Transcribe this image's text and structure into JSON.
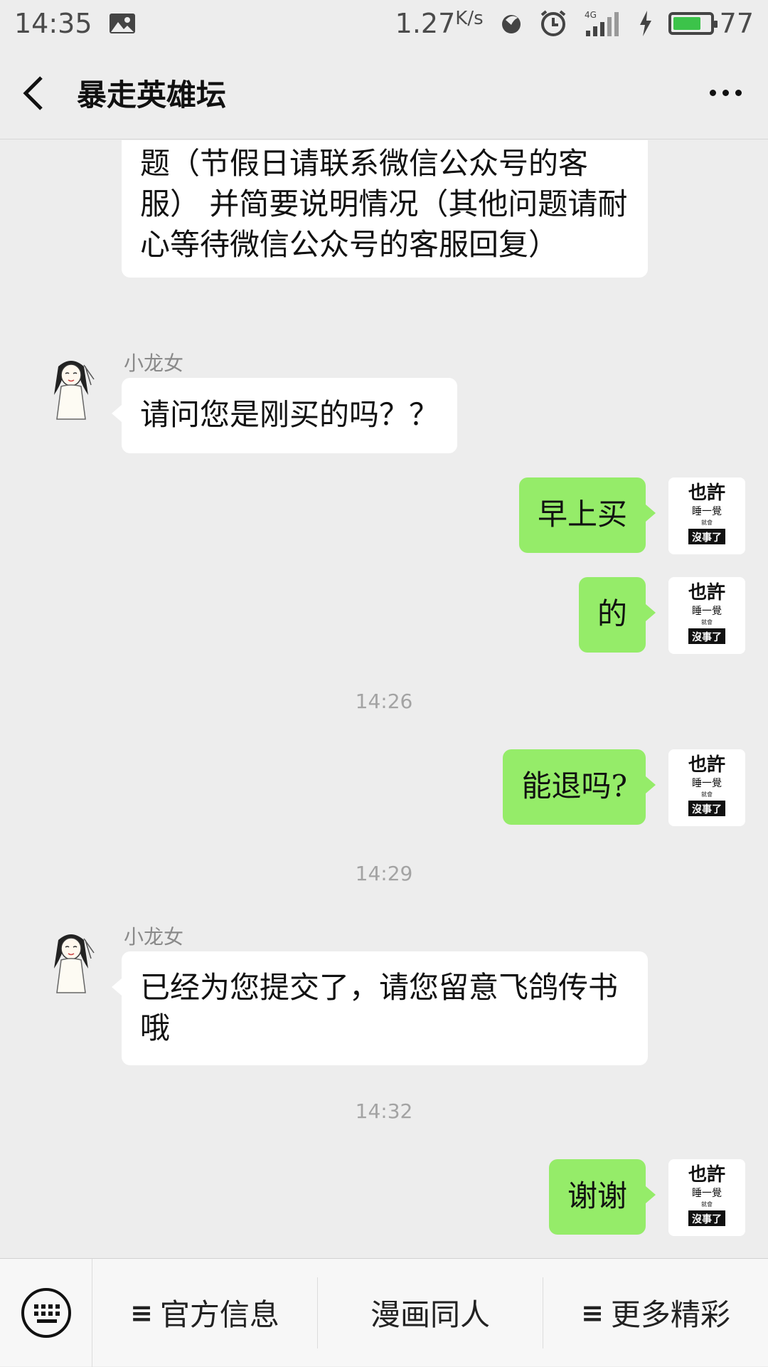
{
  "status_bar": {
    "time": "14:35",
    "net_speed": "1.27",
    "net_unit": "K/s",
    "network_type": "4G",
    "battery_level": "77",
    "battery_fraction": 0.77
  },
  "nav": {
    "title": "暴走英雄坛"
  },
  "messages": [
    {
      "text": "题（节假日请联系微信公众号的客服） 并简要说明情况（其他问题请耐心等待微信公众号的客服回复）"
    },
    {
      "sender": "小龙女",
      "text": "请问您是刚买的吗？？"
    },
    {
      "text": "早上买"
    },
    {
      "text": "的"
    },
    {
      "time": "14:26"
    },
    {
      "text": "能退吗?"
    },
    {
      "time": "14:29"
    },
    {
      "sender": "小龙女",
      "text": "已经为您提交了，请您留意飞鸽传书哦"
    },
    {
      "time": "14:32"
    },
    {
      "text": "谢谢"
    }
  ],
  "my_avatar": {
    "line1": "也許",
    "line2": "睡一覺",
    "line3": "就會",
    "line4": "沒事了"
  },
  "bottom_menu": [
    {
      "label": "官方信息",
      "icon": "≡"
    },
    {
      "label": "漫画同人",
      "icon": ""
    },
    {
      "label": "更多精彩",
      "icon": "≡"
    }
  ],
  "colors": {
    "background": "#ededed",
    "my_bubble": "#95ec69",
    "their_bubble": "#ffffff",
    "battery": "#3cc34a"
  }
}
